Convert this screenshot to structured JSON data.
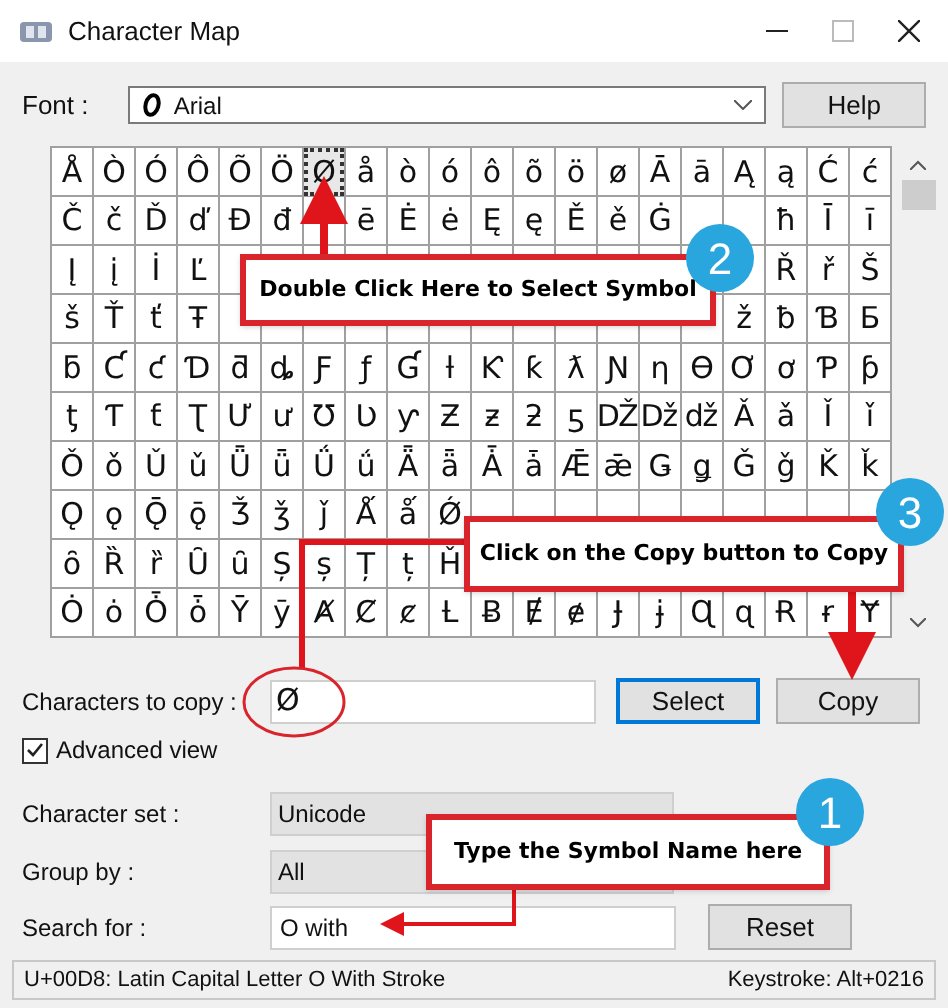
{
  "window": {
    "title": "Character Map"
  },
  "font": {
    "label": "Font :",
    "value": "Arial",
    "help_button": "Help"
  },
  "grid": {
    "rows": [
      [
        {
          "c": "Å",
          "selected": false
        },
        {
          "c": "Ò",
          "selected": false
        },
        {
          "c": "Ó",
          "selected": false
        },
        {
          "c": "Ô",
          "selected": false
        },
        {
          "c": "Õ",
          "selected": false
        },
        {
          "c": "Ö",
          "selected": false
        },
        {
          "c": "Ø",
          "selected": true
        },
        {
          "c": "å",
          "selected": false
        },
        {
          "c": "ò",
          "selected": false
        },
        {
          "c": "ó",
          "selected": false
        },
        {
          "c": "ô",
          "selected": false
        },
        {
          "c": "õ",
          "selected": false
        },
        {
          "c": "ö",
          "selected": false
        },
        {
          "c": "ø",
          "selected": false
        },
        {
          "c": "Ā",
          "selected": false
        },
        {
          "c": "ā",
          "selected": false
        },
        {
          "c": "Ą",
          "selected": false
        },
        {
          "c": "ą",
          "selected": false
        },
        {
          "c": "Ć",
          "selected": false
        },
        {
          "c": "ć",
          "selected": false
        }
      ],
      [
        {
          "c": "Č",
          "selected": false
        },
        {
          "c": "č",
          "selected": false
        },
        {
          "c": "Ď",
          "selected": false
        },
        {
          "c": "ď",
          "selected": false
        },
        {
          "c": "Đ",
          "selected": false
        },
        {
          "c": "đ",
          "selected": false
        },
        null,
        {
          "c": "ē",
          "selected": false
        },
        {
          "c": "Ė",
          "selected": false
        },
        {
          "c": "ė",
          "selected": false
        },
        {
          "c": "Ę",
          "selected": false
        },
        {
          "c": "ę",
          "selected": false
        },
        {
          "c": "Ě",
          "selected": false
        },
        {
          "c": "ě",
          "selected": false
        },
        {
          "c": "Ġ",
          "selected": false
        },
        null,
        null,
        {
          "c": "ħ",
          "selected": false
        },
        {
          "c": "Ī",
          "selected": false
        },
        {
          "c": "ī",
          "selected": false
        }
      ],
      [
        {
          "c": "Į",
          "selected": false
        },
        {
          "c": "į",
          "selected": false
        },
        {
          "c": "İ",
          "selected": false
        },
        {
          "c": "Ľ",
          "selected": false
        },
        null,
        null,
        null,
        null,
        null,
        null,
        null,
        null,
        null,
        null,
        null,
        null,
        null,
        {
          "c": "Ř",
          "selected": false
        },
        {
          "c": "ř",
          "selected": false
        },
        {
          "c": "Š",
          "selected": false
        }
      ],
      [
        {
          "c": "š",
          "selected": false
        },
        {
          "c": "Ť",
          "selected": false
        },
        {
          "c": "ť",
          "selected": false
        },
        {
          "c": "Ŧ",
          "selected": false
        },
        null,
        null,
        null,
        null,
        null,
        null,
        null,
        null,
        null,
        null,
        null,
        null,
        {
          "c": "ž",
          "selected": false
        },
        {
          "c": "ƀ",
          "selected": false
        },
        {
          "c": "Ɓ",
          "selected": false
        },
        {
          "c": "Ƃ",
          "selected": false
        }
      ],
      [
        {
          "c": "ƃ",
          "selected": false
        },
        {
          "c": "Ƈ",
          "selected": false
        },
        {
          "c": "ƈ",
          "selected": false
        },
        {
          "c": "Ɗ",
          "selected": false
        },
        {
          "c": "ƌ",
          "selected": false
        },
        {
          "c": "ȡ",
          "selected": false
        },
        {
          "c": "Ƒ",
          "selected": false
        },
        {
          "c": "ƒ",
          "selected": false
        },
        {
          "c": "Ɠ",
          "selected": false
        },
        {
          "c": "ƚ",
          "selected": false
        },
        {
          "c": "Ƙ",
          "selected": false
        },
        {
          "c": "ƙ",
          "selected": false
        },
        {
          "c": "ƛ",
          "selected": false
        },
        {
          "c": "Ɲ",
          "selected": false
        },
        {
          "c": "ƞ",
          "selected": false
        },
        {
          "c": "Ɵ",
          "selected": false
        },
        {
          "c": "Ơ",
          "selected": false
        },
        {
          "c": "ơ",
          "selected": false
        },
        {
          "c": "Ƥ",
          "selected": false
        },
        {
          "c": "ƥ",
          "selected": false
        }
      ],
      [
        {
          "c": "ƫ",
          "selected": false
        },
        {
          "c": "Ƭ",
          "selected": false
        },
        {
          "c": "ƭ",
          "selected": false
        },
        {
          "c": "Ʈ",
          "selected": false
        },
        {
          "c": "Ư",
          "selected": false
        },
        {
          "c": "ư",
          "selected": false
        },
        {
          "c": "Ʊ",
          "selected": false
        },
        {
          "c": "Ʋ",
          "selected": false
        },
        {
          "c": "ƴ",
          "selected": false
        },
        {
          "c": "Ƶ",
          "selected": false
        },
        {
          "c": "ƶ",
          "selected": false
        },
        {
          "c": "ƻ",
          "selected": false
        },
        {
          "c": "ƽ",
          "selected": false
        },
        {
          "c": "Ǆ",
          "selected": false
        },
        {
          "c": "ǅ",
          "selected": false
        },
        {
          "c": "ǆ",
          "selected": false
        },
        {
          "c": "Ǎ",
          "selected": false
        },
        {
          "c": "ǎ",
          "selected": false
        },
        {
          "c": "Ǐ",
          "selected": false
        },
        {
          "c": "ǐ",
          "selected": false
        }
      ],
      [
        {
          "c": "Ǒ",
          "selected": false
        },
        {
          "c": "ǒ",
          "selected": false
        },
        {
          "c": "Ǔ",
          "selected": false
        },
        {
          "c": "ǔ",
          "selected": false
        },
        {
          "c": "Ǖ",
          "selected": false
        },
        {
          "c": "ǖ",
          "selected": false
        },
        {
          "c": "Ǘ",
          "selected": false
        },
        {
          "c": "ǘ",
          "selected": false
        },
        {
          "c": "Ǟ",
          "selected": false
        },
        {
          "c": "ǟ",
          "selected": false
        },
        {
          "c": "Ǡ",
          "selected": false
        },
        {
          "c": "ǡ",
          "selected": false
        },
        {
          "c": "Ǣ",
          "selected": false
        },
        {
          "c": "ǣ",
          "selected": false
        },
        {
          "c": "Ǥ",
          "selected": false
        },
        {
          "c": "ǥ",
          "selected": false
        },
        {
          "c": "Ǧ",
          "selected": false
        },
        {
          "c": "ǧ",
          "selected": false
        },
        {
          "c": "Ǩ",
          "selected": false
        },
        {
          "c": "ǩ",
          "selected": false
        }
      ],
      [
        {
          "c": "Ǫ",
          "selected": false
        },
        {
          "c": "ǫ",
          "selected": false
        },
        {
          "c": "Ǭ",
          "selected": false
        },
        {
          "c": "ǭ",
          "selected": false
        },
        {
          "c": "Ǯ",
          "selected": false
        },
        {
          "c": "ǯ",
          "selected": false
        },
        {
          "c": "ǰ",
          "selected": false
        },
        {
          "c": "Ǻ",
          "selected": false
        },
        {
          "c": "ǻ",
          "selected": false
        },
        {
          "c": "Ǿ",
          "selected": false
        },
        null,
        null,
        null,
        null,
        null,
        null,
        null,
        null,
        null,
        null
      ],
      [
        {
          "c": "ȏ",
          "selected": false
        },
        {
          "c": "Ȑ",
          "selected": false
        },
        {
          "c": "ȑ",
          "selected": false
        },
        {
          "c": "Ȗ",
          "selected": false
        },
        {
          "c": "ȗ",
          "selected": false
        },
        {
          "c": "Ș",
          "selected": false
        },
        {
          "c": "ș",
          "selected": false
        },
        {
          "c": "Ț",
          "selected": false
        },
        {
          "c": "ț",
          "selected": false
        },
        {
          "c": "Ȟ",
          "selected": false
        },
        null,
        null,
        null,
        null,
        null,
        null,
        null,
        null,
        null,
        null
      ],
      [
        {
          "c": "Ȯ",
          "selected": false
        },
        {
          "c": "ȯ",
          "selected": false
        },
        {
          "c": "Ȱ",
          "selected": false
        },
        {
          "c": "ȱ",
          "selected": false
        },
        {
          "c": "Ȳ",
          "selected": false
        },
        {
          "c": "ȳ",
          "selected": false
        },
        {
          "c": "Ⱥ",
          "selected": false
        },
        {
          "c": "Ȼ",
          "selected": false
        },
        {
          "c": "ȼ",
          "selected": false
        },
        {
          "c": "Ƚ",
          "selected": false
        },
        {
          "c": "Ƀ",
          "selected": false
        },
        {
          "c": "Ɇ",
          "selected": false
        },
        {
          "c": "ɇ",
          "selected": false
        },
        {
          "c": "Ɉ",
          "selected": false
        },
        {
          "c": "ɉ",
          "selected": false
        },
        {
          "c": "Ɋ",
          "selected": false
        },
        {
          "c": "ɋ",
          "selected": false
        },
        {
          "c": "Ɍ",
          "selected": false
        },
        {
          "c": "ɍ",
          "selected": false
        },
        {
          "c": "Ɏ",
          "selected": false
        }
      ]
    ]
  },
  "copy": {
    "label": "Characters to copy :",
    "value": "Ø",
    "select_button": "Select",
    "copy_button": "Copy"
  },
  "advanced_view": {
    "label": "Advanced view",
    "checked": true
  },
  "character_set": {
    "label": "Character set :",
    "value": "Unicode"
  },
  "group_by": {
    "label": "Group by :",
    "value": "All"
  },
  "search": {
    "label": "Search for :",
    "value": "O with",
    "reset_button": "Reset"
  },
  "status_bar": {
    "character": "U+00D8: Latin Capital Letter O With Stroke",
    "keystroke": "Keystroke: Alt+0216"
  },
  "annotations": [
    {
      "number": "2",
      "text": "Double Click Here to Select Symbol"
    },
    {
      "number": "3",
      "text": "Click on the Copy button to Copy"
    },
    {
      "number": "1",
      "text": "Type the Symbol Name here"
    }
  ]
}
